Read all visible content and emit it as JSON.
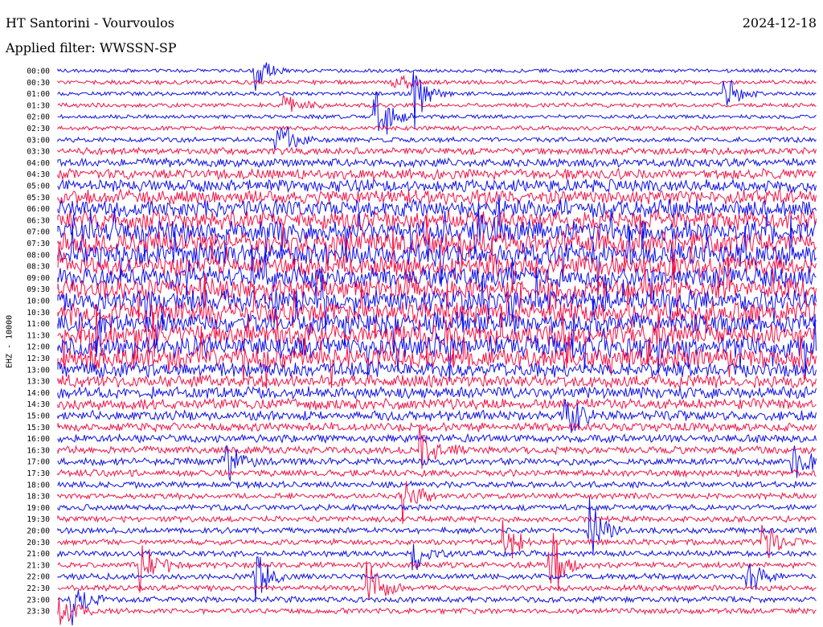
{
  "header": {
    "station": "HT Santorini - Vourvoulos",
    "date": "2024-12-18",
    "filter": "Applied filter: WWSSN-SP"
  },
  "chart_data": {
    "type": "line",
    "title": "HT Santorini - Vourvoulos",
    "subtitle": "Applied filter: WWSSN-SP",
    "ylabel": "EHZ - 10000",
    "xlabel": "",
    "rows": [
      "00:00",
      "00:30",
      "01:00",
      "01:30",
      "02:00",
      "02:30",
      "03:00",
      "03:30",
      "04:00",
      "04:30",
      "05:00",
      "05:30",
      "06:00",
      "06:30",
      "07:00",
      "07:30",
      "08:00",
      "08:30",
      "09:00",
      "09:30",
      "10:00",
      "10:30",
      "11:00",
      "11:30",
      "12:00",
      "12:30",
      "13:00",
      "13:30",
      "14:00",
      "14:30",
      "15:00",
      "15:30",
      "16:00",
      "16:30",
      "17:00",
      "17:30",
      "18:00",
      "18:30",
      "19:00",
      "19:30",
      "20:00",
      "20:30",
      "21:00",
      "21:30",
      "22:00",
      "22:30",
      "23:00",
      "23:30"
    ],
    "colors": [
      "#1010e8",
      "#f01448"
    ],
    "grid": false,
    "activity": [
      0.08,
      0.12,
      0.1,
      0.12,
      0.1,
      0.12,
      0.15,
      0.25,
      0.35,
      0.45,
      0.55,
      0.65,
      0.8,
      0.9,
      1.0,
      1.0,
      1.0,
      1.0,
      1.0,
      1.0,
      1.0,
      1.0,
      1.0,
      1.0,
      1.0,
      0.95,
      0.7,
      0.55,
      0.5,
      0.45,
      0.4,
      0.35,
      0.3,
      0.28,
      0.26,
      0.25,
      0.22,
      0.2,
      0.2,
      0.2,
      0.2,
      0.2,
      0.2,
      0.2,
      0.2,
      0.2,
      0.2,
      0.18
    ],
    "events": [
      {
        "row": 0,
        "t": 0.26,
        "amp": 2.2
      },
      {
        "row": 1,
        "t": 0.44,
        "amp": 1.2
      },
      {
        "row": 2,
        "t": 0.47,
        "amp": 2.8
      },
      {
        "row": 2,
        "t": 0.88,
        "amp": 1.5
      },
      {
        "row": 3,
        "t": 0.3,
        "amp": 1.4
      },
      {
        "row": 4,
        "t": 0.42,
        "amp": 3.0
      },
      {
        "row": 6,
        "t": 0.29,
        "amp": 1.8
      },
      {
        "row": 14,
        "t": 0.55,
        "amp": 2.0
      },
      {
        "row": 30,
        "t": 0.67,
        "amp": 2.4
      },
      {
        "row": 33,
        "t": 0.48,
        "amp": 2.0
      },
      {
        "row": 34,
        "t": 0.22,
        "amp": 2.2
      },
      {
        "row": 34,
        "t": 0.97,
        "amp": 2.6
      },
      {
        "row": 37,
        "t": 0.45,
        "amp": 3.0
      },
      {
        "row": 40,
        "t": 0.7,
        "amp": 2.5
      },
      {
        "row": 41,
        "t": 0.59,
        "amp": 1.8
      },
      {
        "row": 41,
        "t": 0.93,
        "amp": 2.0
      },
      {
        "row": 42,
        "t": 0.47,
        "amp": 1.6
      },
      {
        "row": 43,
        "t": 0.11,
        "amp": 3.0
      },
      {
        "row": 43,
        "t": 0.65,
        "amp": 3.2
      },
      {
        "row": 44,
        "t": 0.26,
        "amp": 2.2
      },
      {
        "row": 44,
        "t": 0.91,
        "amp": 2.0
      },
      {
        "row": 45,
        "t": 0.41,
        "amp": 2.6
      },
      {
        "row": 46,
        "t": 0.02,
        "amp": 1.8
      },
      {
        "row": 47,
        "t": 0.0,
        "amp": 2.5
      }
    ]
  }
}
